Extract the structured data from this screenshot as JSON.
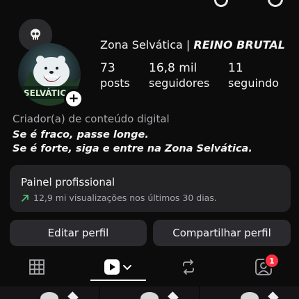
{
  "profile": {
    "name": "Zona Selvática",
    "separator": "|",
    "brand": "REINO BRUTAL",
    "avatar_text": "SELVÁTIC",
    "note_icon": "skull-icon",
    "add_story_icon": "plus-icon"
  },
  "stats": [
    {
      "value": "73",
      "label": "posts"
    },
    {
      "value": "16,8 mil",
      "label": "seguidores"
    },
    {
      "value": "11",
      "label": "seguindo"
    }
  ],
  "bio": {
    "category": "Criador(a) de conteúdo digital",
    "line1": "Se é fraco, passe longe.",
    "line2": "Se é forte, siga e entre na Zona Selvática."
  },
  "professional_panel": {
    "title": "Painel profissional",
    "subtitle": "12,9 mi visualizações nos últimos 30 dias.",
    "trend_icon": "trend-up-icon",
    "trend_color": "#4fc97a"
  },
  "actions": {
    "edit": "Editar perfil",
    "share": "Compartilhar perfil"
  },
  "tabs": [
    {
      "icon": "grid-icon"
    },
    {
      "icon": "reels-play-icon",
      "active": true
    },
    {
      "icon": "repost-icon"
    },
    {
      "icon": "tagged-icon",
      "badge": "1"
    }
  ],
  "colors": {
    "background": "#0c0c0d",
    "panel": "#232326",
    "button": "#2b2b2f",
    "badge": "#ff3040"
  }
}
